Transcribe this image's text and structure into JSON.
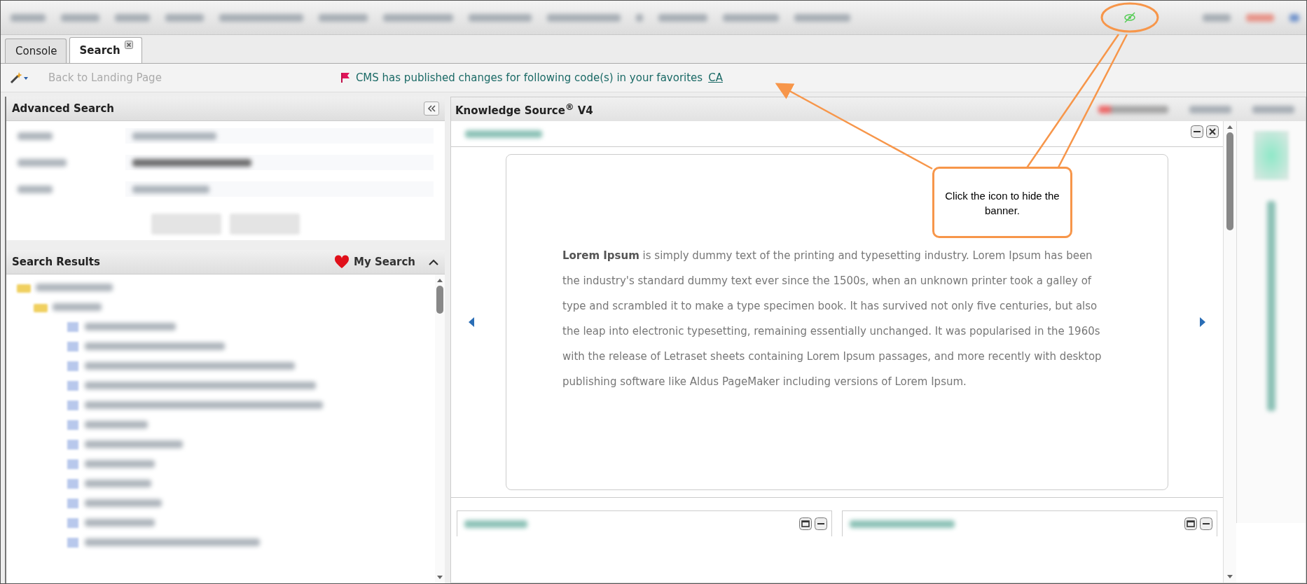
{
  "tabs": [
    {
      "label": "Console",
      "selected": false,
      "closable": false
    },
    {
      "label": "Search",
      "selected": true,
      "closable": true
    }
  ],
  "toolbar": {
    "back_link": "Back to Landing Page",
    "banner": {
      "message": "CMS has published changes for following code(s) in your favorites",
      "link": "CA"
    }
  },
  "advanced_search": {
    "title": "Advanced Search"
  },
  "search_results": {
    "title": "Search Results",
    "favorite_label": "My Search"
  },
  "knowledge_source": {
    "title": "Knowledge Source$^{®}$ V4"
  },
  "product_updates": {
    "paragraph": "**Lorem Ipsum** is simply dummy text of the printing and typesetting industry. Lorem Ipsum has been the industry's standard dummy text ever since the 1500s, when an unknown printer took a galley of type and scrambled it to make a type specimen book. It has survived not only five centuries, but also the leap into electronic typesetting, remaining essentially unchanged. It was popularised in the 1960s with the release of Letraset sheets containing Lorem Ipsum passages, and more recently with desktop publishing software like Aldus PageMaker including versions of Lorem Ipsum."
  },
  "callout": {
    "text": "Click the icon to hide the banner."
  }
}
